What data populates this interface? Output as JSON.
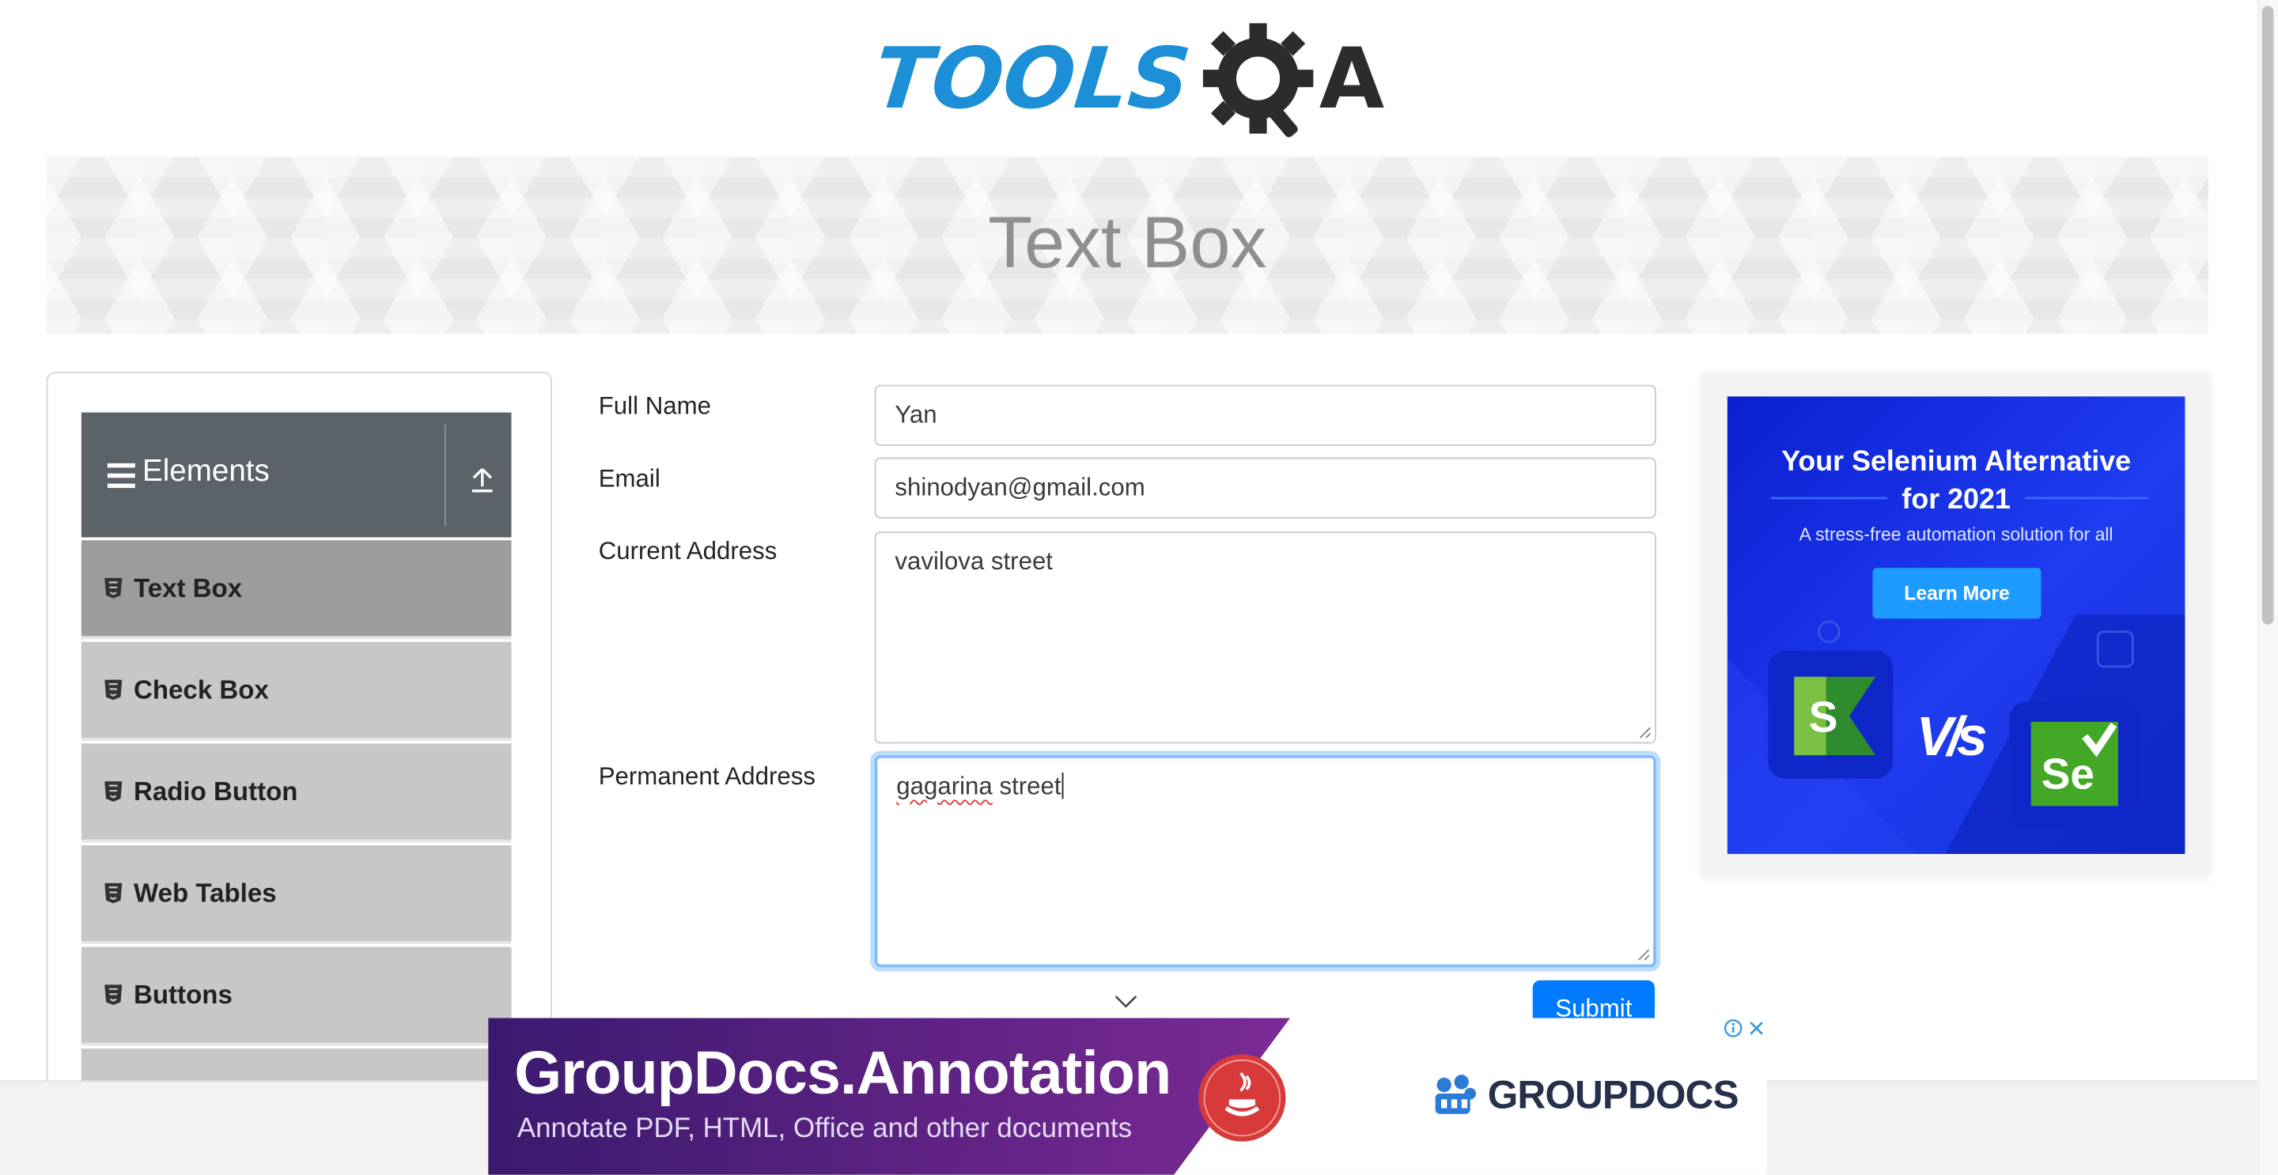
{
  "brand": {
    "logo_text": "TOOLS",
    "logo_letter": "A"
  },
  "page": {
    "title": "Text Box"
  },
  "sidebar": {
    "group_title": "Elements",
    "items": [
      {
        "label": "Text Box",
        "active": true
      },
      {
        "label": "Check Box",
        "active": false
      },
      {
        "label": "Radio Button",
        "active": false
      },
      {
        "label": "Web Tables",
        "active": false
      },
      {
        "label": "Buttons",
        "active": false
      }
    ]
  },
  "form": {
    "full_name": {
      "label": "Full Name",
      "value": "Yan"
    },
    "email": {
      "label": "Email",
      "value": "shinodyan@gmail.com"
    },
    "current_address": {
      "label": "Current Address",
      "value": "vavilova street"
    },
    "permanent_address": {
      "label": "Permanent Address",
      "value_word1": "gagarina",
      "value_word2": "street"
    },
    "submit_label": "Submit"
  },
  "ad_right": {
    "headline_line1": "Your Selenium Alternative",
    "headline_line2": "for 2021",
    "subline": "A stress-free automation solution for all",
    "cta": "Learn More",
    "vs_text": "V/s",
    "left_logo": "S",
    "right_logo": "Se"
  },
  "ad_bottom": {
    "title": "GroupDocs.Annotation",
    "subtitle": "Annotate PDF, HTML, Office and other documents",
    "brand": "GROUPDOCS"
  },
  "colors": {
    "accent": "#007bff",
    "sidebar_header": "#5c6368",
    "menu_item": "#c7c7c7",
    "menu_item_active": "#9c9c9c",
    "logo_blue": "#1c8fd6"
  }
}
